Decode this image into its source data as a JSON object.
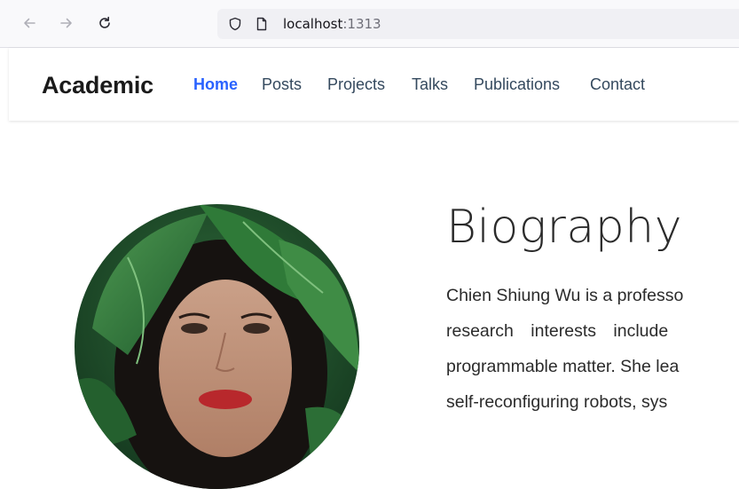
{
  "browser": {
    "url_host": "localhost",
    "url_port": ":1313",
    "icons": {
      "back": "arrow-left-icon",
      "forward": "arrow-right-icon",
      "reload": "reload-icon",
      "tracking": "shield-icon",
      "page": "page-icon"
    }
  },
  "navbar": {
    "brand": "Academic",
    "items": [
      {
        "label": "Home",
        "active": true
      },
      {
        "label": "Posts",
        "active": false
      },
      {
        "label": "Projects",
        "active": false
      },
      {
        "label": "Talks",
        "active": false
      },
      {
        "label": "Publications",
        "active": false
      },
      {
        "label": "Contact",
        "active": false
      }
    ],
    "active_color": "#2962ff"
  },
  "bio": {
    "title": "Biography",
    "lines": [
      "Chien Shiung Wu is a professo",
      "research   interests   include",
      "programmable matter. She lea",
      "self-reconfiguring robots, sys"
    ]
  }
}
